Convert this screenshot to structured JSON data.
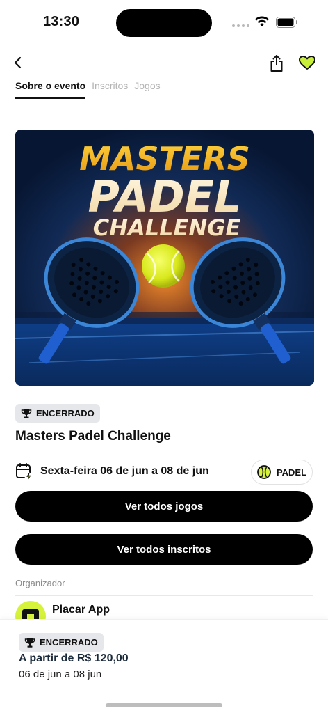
{
  "status_bar": {
    "time": "13:30"
  },
  "nav": {
    "back_icon": "chevron-left-icon",
    "share_icon": "share-icon",
    "favorite_icon": "heart-icon",
    "favorite_color": "#c8ef3a"
  },
  "tabs": [
    {
      "label": "Sobre o evento",
      "active": true
    },
    {
      "label": "Inscritos",
      "active": false
    },
    {
      "label": "Jogos",
      "active": false
    }
  ],
  "banner": {
    "line1": "MASTERS",
    "line2": "PADEL",
    "line3": "CHALLENGE"
  },
  "event": {
    "status_badge": "ENCERRADO",
    "title": "Masters Padel Challenge",
    "date_text": "Sexta-feira 06 de jun a 08 de jun",
    "sport": "PADEL"
  },
  "actions": {
    "all_games": "Ver todos jogos",
    "all_registrations": "Ver todos inscritos"
  },
  "organizer": {
    "label": "Organizador",
    "name": "Placar App"
  },
  "footer": {
    "status_badge": "ENCERRADO",
    "price": "A partir de R$ 120,00",
    "dates": "06 de jun a 08 jun"
  },
  "colors": {
    "accent_lime": "#d7f23a",
    "primary_button": "#000000",
    "badge_bg": "#e5e7ea"
  }
}
